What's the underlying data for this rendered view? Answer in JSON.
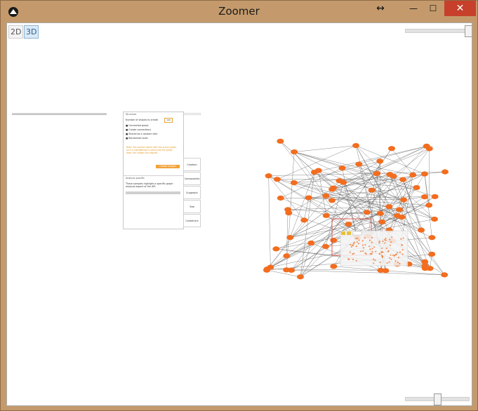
{
  "window": {
    "title": "Zoomer"
  },
  "toolbar": {
    "btn_2d": "2D",
    "btn_3d": "3D"
  },
  "controls": {
    "resize_glyph": "↔",
    "min_glyph": "—",
    "max_glyph": "☐",
    "close_glyph": "✕"
  },
  "panel": {
    "section_title": "Structure",
    "shape_count_label": "Number of shapes to create",
    "shape_count_value": "140",
    "checkboxes": [
      "Connected graph",
      "Create connections",
      "Should be a random tree",
      "Randomize sizes"
    ],
    "note": "Note: the zoomer works with the scene graph, so it is highlighting to easily see the graph data, the shapes are aligned",
    "create_button": "Create shapes",
    "analysis_title": "Analysis specific",
    "analysis_text": "These samples highlight a specific graph analysis aspect of the API."
  },
  "tabs": [
    "Creation",
    "Components",
    "Supgraph",
    "Tree",
    "Containers"
  ],
  "sliders": {
    "top_zoom_level": 1.0,
    "bottom_zoom_level": 0.7
  },
  "colors": {
    "node": "#f26d1f",
    "edge": "#555555",
    "selection": "#d9382b",
    "titlebar": "#c49a6c",
    "close": "#c7402b"
  }
}
